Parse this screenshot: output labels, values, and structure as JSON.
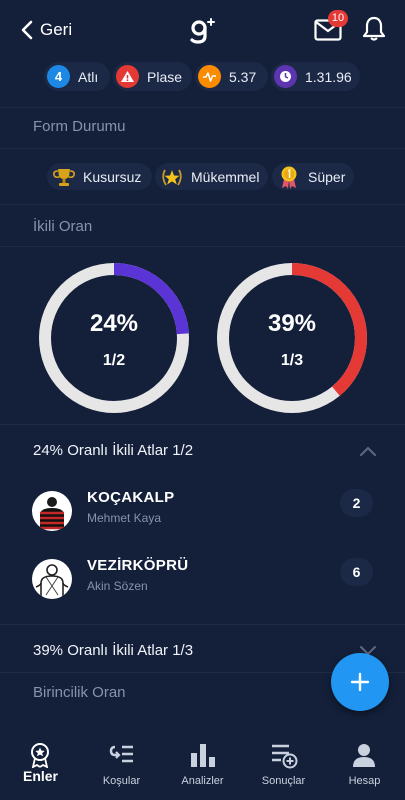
{
  "header": {
    "back_label": "Geri",
    "logo_text": "g+",
    "mail_badge": "10"
  },
  "stats": [
    {
      "icon_text": "4",
      "label": "Atlı",
      "color": "#1e88e5",
      "icon": "number-icon"
    },
    {
      "icon_text": "!",
      "label": "Plase",
      "color": "#e53935",
      "icon": "warning-icon"
    },
    {
      "icon_text": "",
      "label": "5.37",
      "color": "#fb8c00",
      "icon": "pulse-icon"
    },
    {
      "icon_text": "",
      "label": "1.31.96",
      "color": "#5e35b1",
      "icon": "clock-icon"
    }
  ],
  "form": {
    "title": "Form Durumu",
    "items": [
      {
        "label": "Kusursuz",
        "icon": "trophy-icon"
      },
      {
        "label": "Mükemmel",
        "icon": "laurel-star-icon"
      },
      {
        "label": "Süper",
        "icon": "medal-icon"
      }
    ]
  },
  "ikili": {
    "title": "İkili Oran",
    "donuts": [
      {
        "percent_label": "24%",
        "ratio": "1/2",
        "fraction": 0.24,
        "color": "#5b34d6"
      },
      {
        "percent_label": "39%",
        "ratio": "1/3",
        "fraction": 0.39,
        "color": "#e53935"
      }
    ]
  },
  "group1": {
    "title": "24% Oranlı İkili Atlar 1/2",
    "horses": [
      {
        "name": "KOÇAKALP",
        "jockey": "Mehmet Kaya",
        "count": "2"
      },
      {
        "name": "VEZİRKÖPRÜ",
        "jockey": "Akin Sözen",
        "count": "6"
      }
    ]
  },
  "group2": {
    "title": "39% Oranlı İkili Atlar 1/3"
  },
  "birincilik": {
    "title": "Birincilik Oran"
  },
  "nav": [
    {
      "label": "Enler",
      "icon": "award-icon",
      "active": true
    },
    {
      "label": "Koşular",
      "icon": "races-icon",
      "active": false
    },
    {
      "label": "Analizler",
      "icon": "bar-chart-icon",
      "active": false
    },
    {
      "label": "Sonuçlar",
      "icon": "results-list-icon",
      "active": false
    },
    {
      "label": "Hesap",
      "icon": "user-icon",
      "active": false
    }
  ],
  "colors": {
    "background": "#14203a",
    "card": "#1b2946",
    "track": "#e6e6e6",
    "fab": "#2196f3"
  }
}
